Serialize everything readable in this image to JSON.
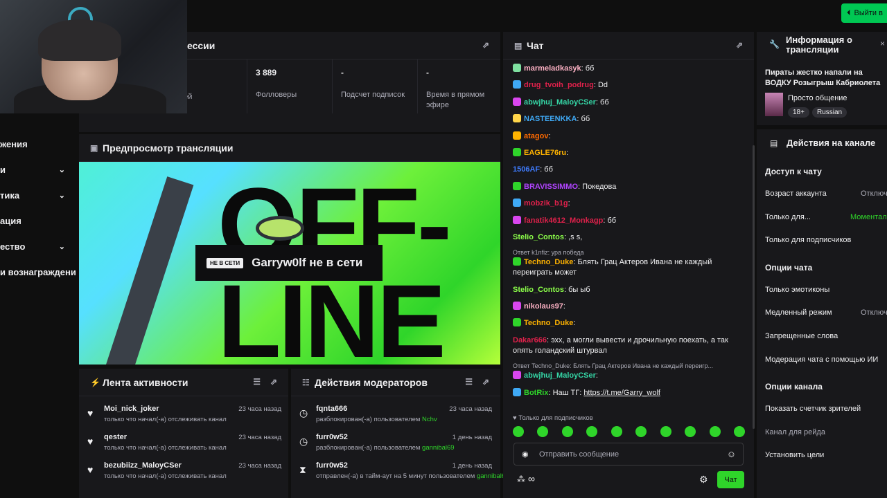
{
  "header": {
    "exit_label": "Выйти в"
  },
  "session": {
    "title": "ессии",
    "viewers_label": "телей",
    "followers_value": "3 889",
    "followers_label": "Фолловеры",
    "subs_value": "-",
    "subs_label": "Подсчет подписок",
    "uptime_value": "-",
    "uptime_label": "Время в прямом эфире"
  },
  "sidenav": [
    {
      "label": "жения"
    },
    {
      "label": "и",
      "chevron": true
    },
    {
      "label": "тика",
      "chevron": true
    },
    {
      "label": "ация"
    },
    {
      "label": "ество",
      "chevron": true
    },
    {
      "label": "и вознаграждени"
    }
  ],
  "preview": {
    "title": "Предпросмотр трансляции",
    "offline_text": "OFF-LINE",
    "offline_tag": "НЕ В СЕТИ",
    "offline_message": "Garryw0lf не в сети"
  },
  "activity": {
    "title": "Лента активности",
    "items": [
      {
        "name": "Moi_nick_joker",
        "time": "23 часа назад",
        "text": "только что начал(-а) отслеживать канал",
        "icon": "heart"
      },
      {
        "name": "qester",
        "time": "23 часа назад",
        "text": "только что начал(-а) отслеживать канал",
        "icon": "heart"
      },
      {
        "name": "bezubiizz_MaloyCSer",
        "time": "23 часа назад",
        "text": "только что начал(-а) отслеживать канал",
        "icon": "heart"
      }
    ]
  },
  "moderators": {
    "title": "Действия модераторов",
    "items": [
      {
        "name": "fqnta666",
        "time": "23 часа назад",
        "text": "разблокирован(-а) пользователем ",
        "who": "Nchv",
        "icon": "clock"
      },
      {
        "name": "furr0w52",
        "time": "1 день назад",
        "text": "разблокирован(-а) пользователем ",
        "who": "gannibal69",
        "icon": "clock"
      },
      {
        "name": "furr0w52",
        "time": "1 день назад",
        "text": "отправлен(-а) в тайм-аут на 5 минут пользователем ",
        "who": "gannibal69",
        "icon": "hourglass"
      }
    ]
  },
  "chat": {
    "title": "Чат",
    "messages": [
      {
        "user": "marmeladkasyk",
        "color": "#ffb3c6",
        "badge": "#7fe0a0",
        "text": "бб"
      },
      {
        "user": "drug_tvoih_podrug",
        "color": "#e0214b",
        "badge": "#3fa9f5",
        "text": "Dd"
      },
      {
        "user": "abwjhuj_MaloyCSer",
        "color": "#35d6a6",
        "badge": "#d946ef",
        "text": "бб"
      },
      {
        "user": "NASTEENKKA",
        "color": "#3fa9f5",
        "badge": "#ffd54a",
        "text": "бб"
      },
      {
        "user": "atagov",
        "color": "#ff6a00",
        "badge": "#ffb300",
        "text": ""
      },
      {
        "user": "EAGLE76ru",
        "color": "#ffb300",
        "badge": "#2fd52a",
        "text": ""
      },
      {
        "user": "1506AF",
        "color": "#3f7cff",
        "badge": "",
        "text": "бб"
      },
      {
        "user": "BRAVISSIMMO",
        "color": "#b044ff",
        "badge": "#2fd52a",
        "text": "Покедова"
      },
      {
        "user": "mobzik_b1g",
        "color": "#e0214b",
        "badge": "#3fa9f5",
        "text": ""
      },
      {
        "user": "fanatik4612_Monkagp",
        "color": "#e0214b",
        "badge": "#d946ef",
        "text": "бб"
      },
      {
        "user": "Stelio_Contos",
        "color": "#8cff4a",
        "badge": "",
        "text": ",s s,"
      }
    ],
    "reply1": "Ответ k1nfiz: ура победа",
    "msg2": [
      {
        "user": "Techno_Duke",
        "color": "#ffb300",
        "badge": "#2fd52a",
        "text": "Блять Грац Актеров Ивана не каждый переиграть может"
      },
      {
        "user": "Stelio_Contos",
        "color": "#8cff4a",
        "badge": "",
        "text": "бы ыб"
      },
      {
        "user": "nikolaus97",
        "color": "#ffb3c6",
        "badge": "#d946ef",
        "text": ""
      },
      {
        "user": "Techno_Duke",
        "color": "#ffb300",
        "badge": "#2fd52a",
        "text": ""
      },
      {
        "user": "Dakar666",
        "color": "#e0214b",
        "badge": "",
        "text": "эхх, а могли вывести и дрочильную поехать, а так опять голандский штурвал"
      }
    ],
    "reply2": "Ответ Techno_Duke: Блять Грац Актеров Ивана не каждый переигр...",
    "msg3": [
      {
        "user": "abwjhuj_MaloyCSer",
        "color": "#35d6a6",
        "badge": "#d946ef",
        "text": ""
      },
      {
        "user": "BotRix",
        "color": "#2fd52a",
        "badge": "#3fa9f5",
        "text": "Наш ТГ: ",
        "link": "https://t.me/Garry_wolf"
      }
    ],
    "subs_only": "Только для подписчиков",
    "placeholder": "Отправить сообщение",
    "send_label": "Чат",
    "points": "∞"
  },
  "info": {
    "title": "Информация о трансляции",
    "stream_title": "Пираты жестко напали на ВОДКУ Розыгрыш Кабриолета в ТГ,ТG,",
    "category": "Просто общение",
    "tags": [
      "18+",
      "Russian"
    ]
  },
  "actions": {
    "title": "Действия на канале",
    "sections": [
      {
        "heading": "Доступ к чату",
        "options": [
          {
            "label": "Возраст аккаунта",
            "value": "Отключ"
          },
          {
            "label": "Только для...",
            "value": "Моментал",
            "accent": true
          },
          {
            "label": "Только для подписчиков",
            "value": ""
          }
        ]
      },
      {
        "heading": "Опции чата",
        "options": [
          {
            "label": "Только эмотиконы",
            "value": ""
          },
          {
            "label": "Медленный режим",
            "value": "Отключ"
          },
          {
            "label": "Запрещенные слова",
            "value": ""
          },
          {
            "label": "Модерация чата с помощью ИИ",
            "value": ""
          }
        ]
      },
      {
        "heading": "Опции канала",
        "options": [
          {
            "label": "Показать счетчик зрителей",
            "value": ""
          },
          {
            "label": "Канал для рейда",
            "value": "",
            "dim": true
          },
          {
            "label": "Установить цели",
            "value": ""
          }
        ]
      }
    ]
  },
  "colors": {
    "accent": "#2fd52a",
    "bg": "#0f0f0f",
    "panel": "#18181b"
  }
}
